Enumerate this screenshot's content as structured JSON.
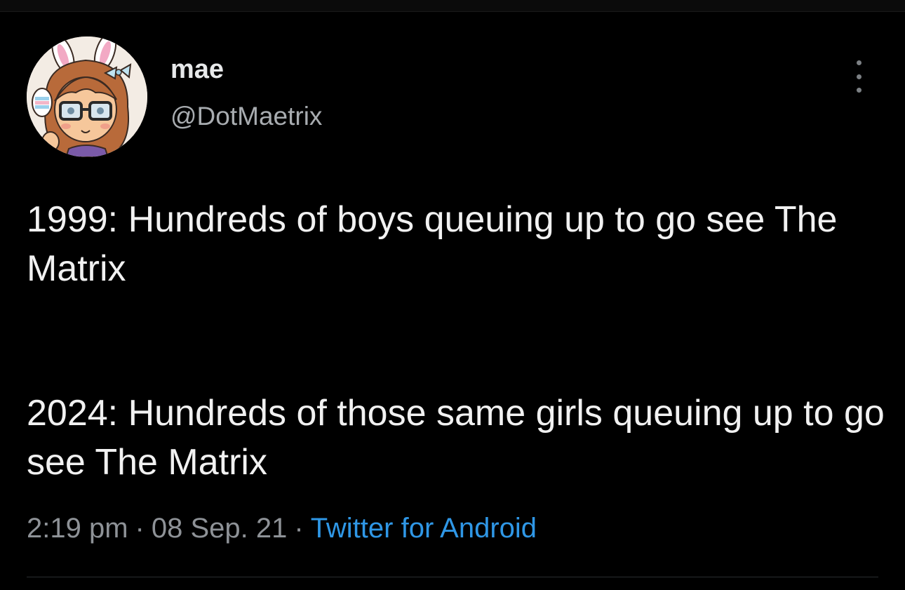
{
  "user": {
    "display_name": "mae",
    "handle": "@DotMaetrix",
    "avatar_icon": "cartoon-avatar-icon"
  },
  "menu": {
    "more_icon": "more-vertical-icon"
  },
  "tweet": {
    "paragraphs": [
      "1999: Hundreds of boys queuing up to go see The Matrix",
      "2024: Hundreds of those same girls queuing up to go see The Matrix"
    ]
  },
  "meta": {
    "time": "2:19 pm",
    "separator": "·",
    "date": "08 Sep. 21",
    "source": "Twitter for Android"
  },
  "colors": {
    "background": "#000000",
    "text": "#e7e9ea",
    "muted": "#8e9297",
    "link": "#2f97e6"
  }
}
